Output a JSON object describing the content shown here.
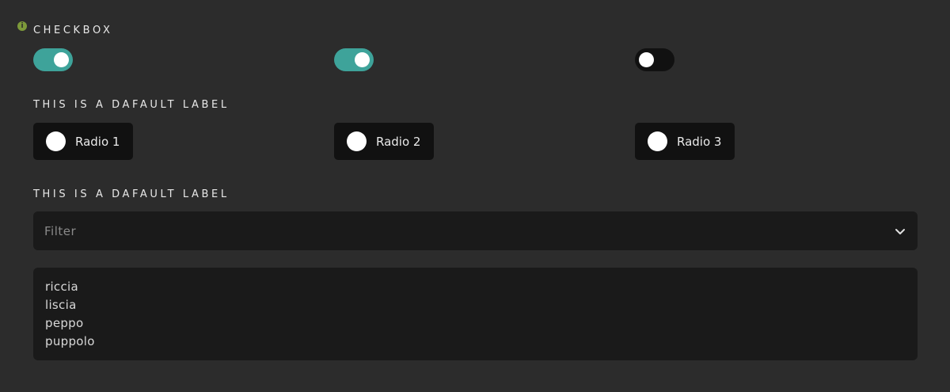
{
  "info_icon": "i",
  "checkbox_section": {
    "label": "CHECKBOX",
    "toggles": [
      {
        "state": true
      },
      {
        "state": true
      },
      {
        "state": false
      }
    ],
    "on_color": "#3ea39a",
    "off_color": "#111111"
  },
  "radio_section": {
    "label": "THIS IS A DAFAULT LABEL",
    "options": [
      "Radio 1",
      "Radio 2",
      "Radio 3"
    ]
  },
  "select_section": {
    "label": "THIS IS A DAFAULT LABEL",
    "placeholder": "Filter",
    "list_options": [
      "riccia",
      "liscia",
      "peppo",
      "puppolo"
    ]
  }
}
